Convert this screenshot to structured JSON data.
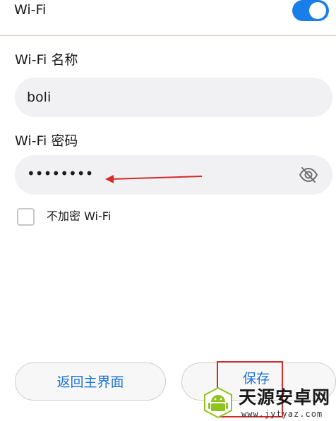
{
  "wifi": {
    "title": "Wi-Fi",
    "enabled": true,
    "accent_color": "#1a7ee8"
  },
  "form": {
    "name_label": "Wi-Fi 名称",
    "name_value": "boli",
    "password_label": "Wi-Fi 密码",
    "password_value": "••••••••",
    "password_toggle_icon": "eye-off-icon",
    "no_encryption_label": "不加密 Wi-Fi",
    "no_encryption_checked": false
  },
  "buttons": {
    "back_label": "返回主界面",
    "save_label": "保存"
  },
  "annotations": {
    "arrow_color": "#d32b2b",
    "highlight_color": "#d32b2b"
  },
  "watermark": {
    "title": "天源安卓网",
    "url": "www.jytyaz.com"
  }
}
